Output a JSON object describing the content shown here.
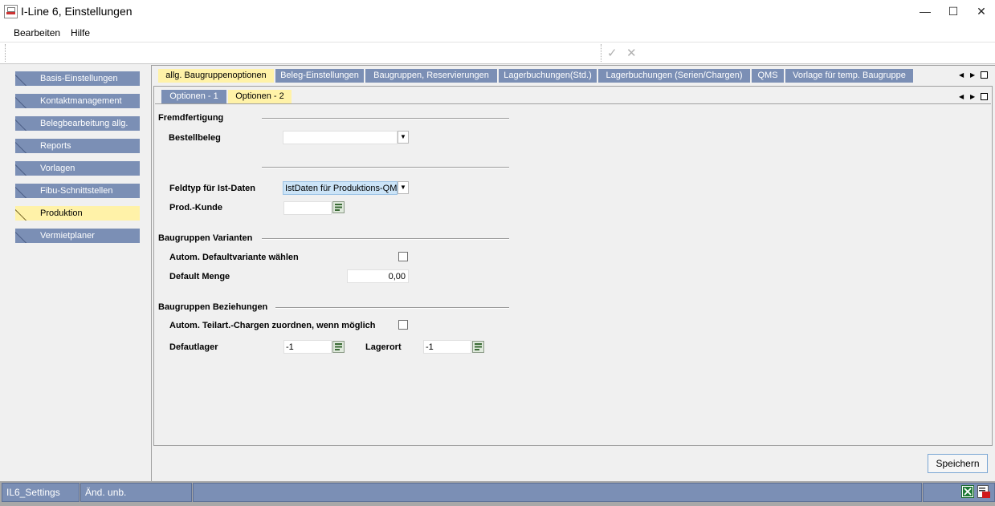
{
  "window": {
    "title": "I-Line 6, Einstellungen",
    "minimize": "—",
    "maximize": "☐",
    "close": "✕"
  },
  "menu": {
    "items": [
      "Bearbeiten",
      "Hilfe"
    ]
  },
  "toolbar": {
    "confirm_icon": "✓",
    "cancel_icon": "✕"
  },
  "sidebar": {
    "items": [
      {
        "label": "Basis-Einstellungen"
      },
      {
        "label": "Kontaktmanagement"
      },
      {
        "label": "Belegbearbeitung allg."
      },
      {
        "label": "Reports"
      },
      {
        "label": "Vorlagen"
      },
      {
        "label": "Fibu-Schnittstellen"
      },
      {
        "label": "Produktion",
        "active": true
      },
      {
        "label": "Vermietplaner"
      }
    ]
  },
  "tabs": {
    "items": [
      "allg. Baugruppenoptionen",
      "Beleg-Einstellungen",
      "Baugruppen, Reservierungen",
      "Lagerbuchungen(Std.)",
      "Lagerbuchungen (Serien/Chargen)",
      "QMS",
      "Vorlage für temp. Baugruppe"
    ],
    "active": "allg. Baugruppenoptionen"
  },
  "subtabs": {
    "items": [
      "Optionen - 1",
      "Optionen - 2"
    ],
    "active": "Optionen - 2"
  },
  "form": {
    "fremdfertigung": {
      "title": "Fremdfertigung",
      "bestellbeleg_label": "Bestellbeleg",
      "bestellbeleg_value": "",
      "feldtyp_label": "Feldtyp für Ist-Daten",
      "feldtyp_value": "IstDaten für Produktions-QM",
      "prodkunde_label": "Prod.-Kunde",
      "prodkunde_value": ""
    },
    "varianten": {
      "title": "Baugruppen Varianten",
      "defaultvariante_label": "Autom. Defaultvariante wählen",
      "defaultvariante_checked": false,
      "defaultmenge_label": "Default Menge",
      "defaultmenge_value": "0,00"
    },
    "beziehungen": {
      "title": "Baugruppen Beziehungen",
      "chargen_label": "Autom. Teilart.-Chargen zuordnen, wenn möglich",
      "chargen_checked": false,
      "defaultlager_label": "Defautlager",
      "defaultlager_value": "-1",
      "lagerort_label": "Lagerort",
      "lagerort_value": "-1"
    }
  },
  "actions": {
    "save_label": "Speichern"
  },
  "status": {
    "cell1": "IL6_Settings",
    "cell2": "Änd. unb."
  },
  "colors": {
    "tab_inactive": "#7b8fb5",
    "tab_active": "#fff2a8",
    "background": "#f0f0f0"
  }
}
